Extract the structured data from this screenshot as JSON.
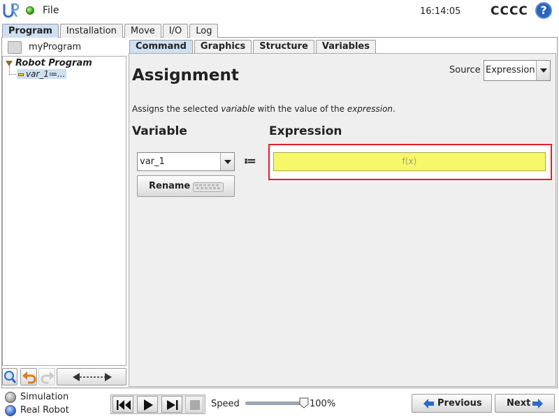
{
  "header": {
    "file_menu": "File",
    "clock": "16:14:05",
    "robot_name": "CCCC",
    "help": "?"
  },
  "main_tabs": [
    "Program",
    "Installation",
    "Move",
    "I/O",
    "Log"
  ],
  "program": {
    "name": "myProgram",
    "tree_root": "Robot Program",
    "tree_child": "var_1≔..."
  },
  "sub_tabs": [
    "Command",
    "Graphics",
    "Structure",
    "Variables"
  ],
  "command": {
    "title": "Assignment",
    "source_label": "Source",
    "source_value": "Expression",
    "desc_part1": "Assigns the selected ",
    "desc_var": "variable",
    "desc_part2": " with the value of the ",
    "desc_expr": "expression",
    "desc_part3": ".",
    "variable_heading": "Variable",
    "expression_heading": "Expression",
    "variable_value": "var_1",
    "assign_operator": "≔",
    "rename_label": "Rename",
    "expression_placeholder": "f(x)"
  },
  "footer": {
    "simulation_label": "Simulation",
    "real_robot_label": "Real Robot",
    "speed_label": "Speed",
    "speed_value": "100%",
    "speed_fraction": 1.0,
    "previous_label": "Previous",
    "next_label": "Next"
  },
  "colors": {
    "expression_field": "#f7f76a",
    "highlight_border": "#e0202a",
    "active_tab": "#cfe0f2",
    "arrow_blue": "#2f68c8"
  },
  "icons": [
    "ur-logo-icon",
    "status-dot-icon",
    "help-icon",
    "program-file-icon",
    "search-icon",
    "undo-icon",
    "redo-icon",
    "move-arrows-icon",
    "keyboard-icon",
    "rewind-icon",
    "play-icon",
    "step-icon",
    "stop-icon",
    "arrow-left-icon",
    "arrow-right-icon"
  ]
}
